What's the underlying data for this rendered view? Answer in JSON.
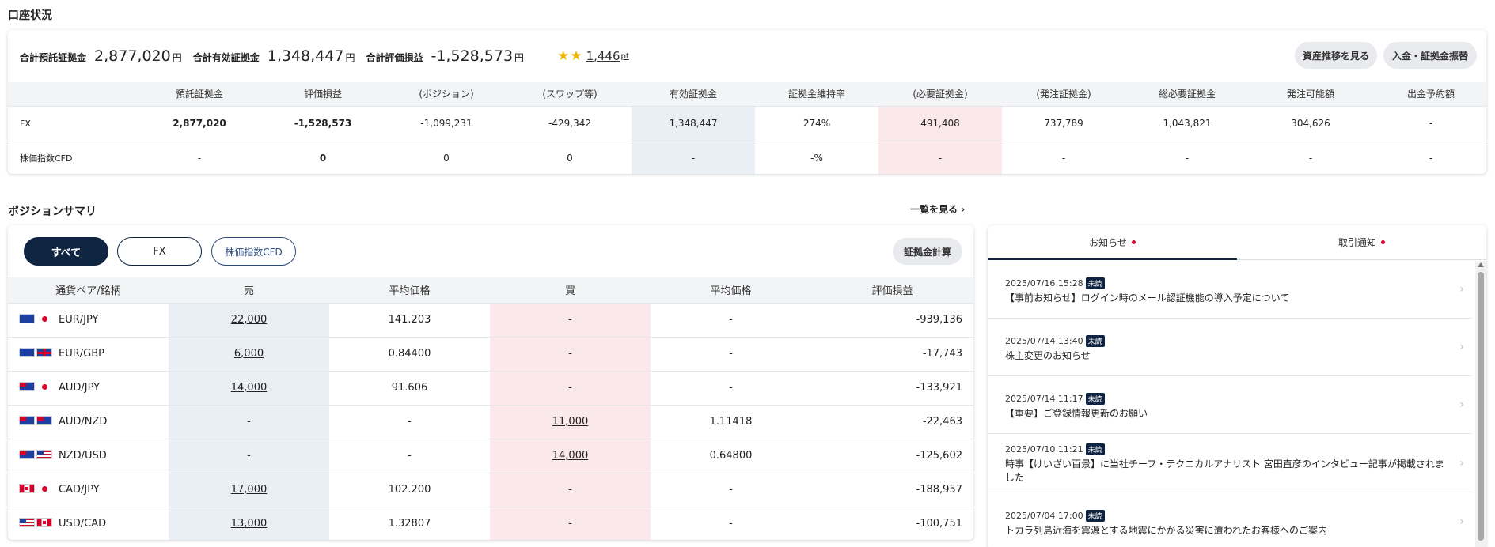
{
  "account": {
    "section_title": "口座状況",
    "summary": [
      {
        "label": "合計預託証拠金",
        "value": "2,877,020",
        "unit": "円"
      },
      {
        "label": "合計有効証拠金",
        "value": "1,348,447",
        "unit": "円"
      },
      {
        "label": "合計評価損益",
        "value": "-1,528,573",
        "unit": "円"
      }
    ],
    "points": {
      "star_count": 2,
      "value": "1,446",
      "unit": "pt"
    },
    "buttons": {
      "asset_history": "資産推移を見る",
      "deposit_transfer": "入金・証拠金振替"
    },
    "columns": [
      "",
      "預託証拠金",
      "評価損益",
      "(ポジション)",
      "(スワップ等)",
      "有効証拠金",
      "証拠金維持率",
      "(必要証拠金)",
      "(発注証拠金)",
      "総必要証拠金",
      "発注可能額",
      "出金予約額"
    ],
    "rows": [
      {
        "label": "FX",
        "values": [
          "2,877,020",
          "-1,528,573",
          "-1,099,231",
          "-429,342",
          "1,348,447",
          "274%",
          "491,408",
          "737,789",
          "1,043,821",
          "304,626",
          "-"
        ]
      },
      {
        "label": "株価指数CFD",
        "values": [
          "-",
          "0",
          "0",
          "0",
          "-",
          "-%",
          "-",
          "-",
          "-",
          "-",
          "-"
        ]
      }
    ]
  },
  "positions": {
    "section_title": "ポジションサマリ",
    "more_link": "一覧を見る",
    "tabs": {
      "all": "すべて",
      "fx": "FX",
      "cfd": "株価指数CFD"
    },
    "calc_button": "証拠金計算",
    "columns": [
      "通貨ペア/銘柄",
      "売",
      "平均価格",
      "買",
      "平均価格",
      "評価損益"
    ],
    "rows": [
      {
        "pair": "EUR/JPY",
        "sell": "22,000",
        "sell_avg": "141.203",
        "buy": "-",
        "buy_avg": "-",
        "pl": "-939,136"
      },
      {
        "pair": "EUR/GBP",
        "sell": "6,000",
        "sell_avg": "0.84400",
        "buy": "-",
        "buy_avg": "-",
        "pl": "-17,743"
      },
      {
        "pair": "AUD/JPY",
        "sell": "14,000",
        "sell_avg": "91.606",
        "buy": "-",
        "buy_avg": "-",
        "pl": "-133,921"
      },
      {
        "pair": "AUD/NZD",
        "sell": "-",
        "sell_avg": "-",
        "buy": "11,000",
        "buy_avg": "1.11418",
        "pl": "-22,463"
      },
      {
        "pair": "NZD/USD",
        "sell": "-",
        "sell_avg": "-",
        "buy": "14,000",
        "buy_avg": "0.64800",
        "pl": "-125,602"
      },
      {
        "pair": "CAD/JPY",
        "sell": "17,000",
        "sell_avg": "102.200",
        "buy": "-",
        "buy_avg": "-",
        "pl": "-188,957"
      },
      {
        "pair": "USD/CAD",
        "sell": "13,000",
        "sell_avg": "1.32807",
        "buy": "-",
        "buy_avg": "-",
        "pl": "-100,751"
      }
    ]
  },
  "notices": {
    "tabs": {
      "news": "お知らせ",
      "trade": "取引通知"
    },
    "badge": "未読",
    "items": [
      {
        "date": "2025/07/16 15:28",
        "title": "【事前お知らせ】ログイン時のメール認証機能の導入予定について"
      },
      {
        "date": "2025/07/14 13:40",
        "title": "株主変更のお知らせ"
      },
      {
        "date": "2025/07/14 11:17",
        "title": "【重要】ご登録情報更新のお願い"
      },
      {
        "date": "2025/07/10 11:21",
        "title": "時事【けいざい百景】に当社チーフ・テクニカルアナリスト 宮田直彦のインタビュー記事が掲載されました"
      },
      {
        "date": "2025/07/04 17:00",
        "title": "トカラ列島近海を震源とする地震にかかる災害に遭われたお客様へのご案内"
      }
    ]
  },
  "colors": {
    "navy": "#0f2440",
    "blue_cell": "#eaeef5",
    "pink_cell": "#fbe8ea",
    "star": "#f0b400",
    "unread_dot": "#d8002a"
  }
}
